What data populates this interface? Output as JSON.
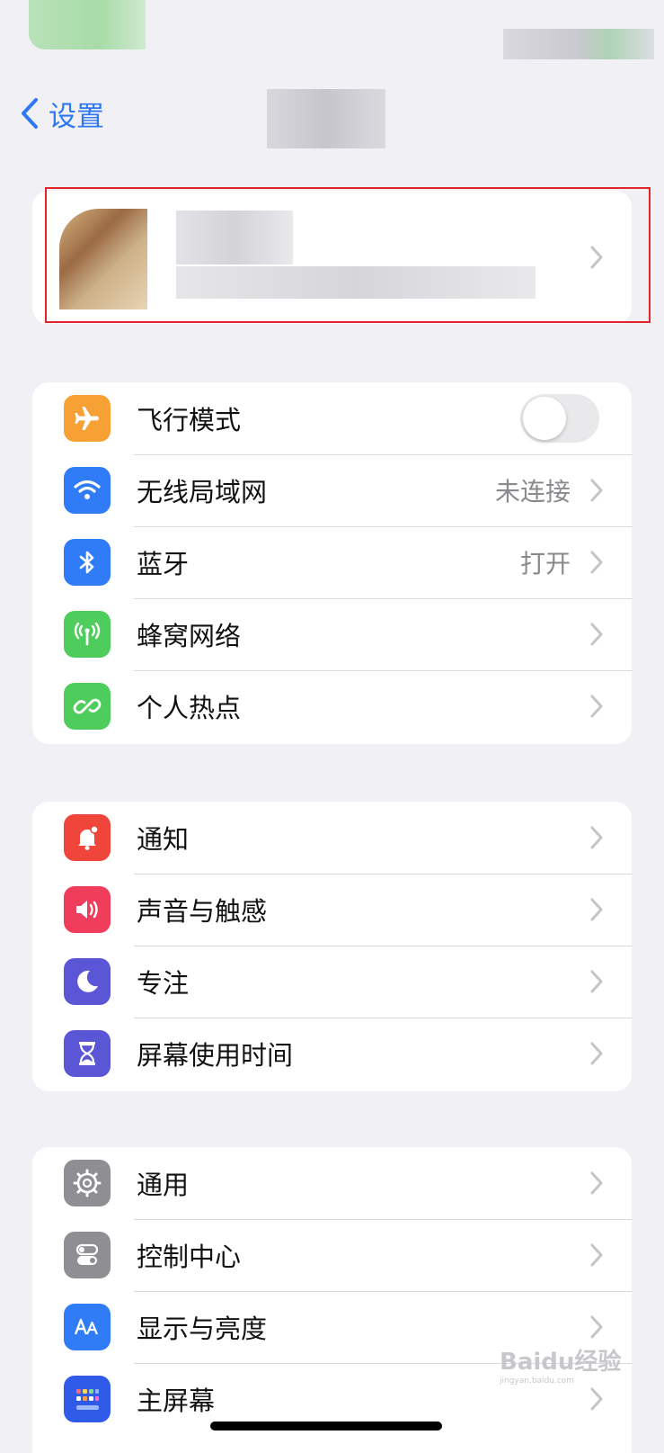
{
  "nav": {
    "back_label": "设置"
  },
  "watermark": {
    "brand": "Baidu经验",
    "url": "jingyan.baidu.com"
  },
  "group1": [
    {
      "label": "飞行模式",
      "icon": "airplane-icon",
      "color": "#f7a033",
      "toggle": false
    },
    {
      "label": "无线局域网",
      "icon": "wifi-icon",
      "color": "#2f7cf6",
      "value": "未连接"
    },
    {
      "label": "蓝牙",
      "icon": "bluetooth-icon",
      "color": "#2f7cf6",
      "value": "打开"
    },
    {
      "label": "蜂窝网络",
      "icon": "cellular-icon",
      "color": "#4fcd5c"
    },
    {
      "label": "个人热点",
      "icon": "hotspot-icon",
      "color": "#4fcd5c"
    }
  ],
  "group2": [
    {
      "label": "通知",
      "icon": "notification-bell-icon",
      "color": "#f0453a"
    },
    {
      "label": "声音与触感",
      "icon": "speaker-icon",
      "color": "#ef3d5b"
    },
    {
      "label": "专注",
      "icon": "moon-icon",
      "color": "#5b56d6"
    },
    {
      "label": "屏幕使用时间",
      "icon": "hourglass-icon",
      "color": "#5b56d6"
    }
  ],
  "group3": [
    {
      "label": "通用",
      "icon": "gear-icon",
      "color": "#8e8e93"
    },
    {
      "label": "控制中心",
      "icon": "control-center-icon",
      "color": "#8e8e93"
    },
    {
      "label": "显示与亮度",
      "icon": "text-size-icon",
      "color": "#2f7cf6"
    },
    {
      "label": "主屏幕",
      "icon": "home-screen-icon",
      "color": "#2f5be8"
    }
  ]
}
